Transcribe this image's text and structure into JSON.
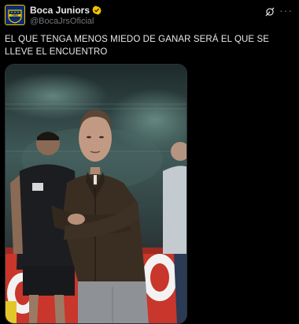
{
  "post": {
    "author_name": "Boca Juniors",
    "author_handle": "@BocaJrsOficial",
    "avatar_logo_text": "CABJ",
    "text": "EL QUE TENGA MENOS MIEDO DE GANAR SERÁ EL QUE SE LLEVE EL ENCUENTRO",
    "more_label": "···"
  },
  "colors": {
    "background": "#000000",
    "text": "#e7e9ea",
    "muted": "#71767b",
    "verified_badge": "#f2c500",
    "boca_blue": "#0a2d6e",
    "boca_gold": "#f2c500"
  },
  "icons": {
    "verified": "verified-badge-icon",
    "grok": "grok-icon",
    "more": "more-options-icon"
  }
}
